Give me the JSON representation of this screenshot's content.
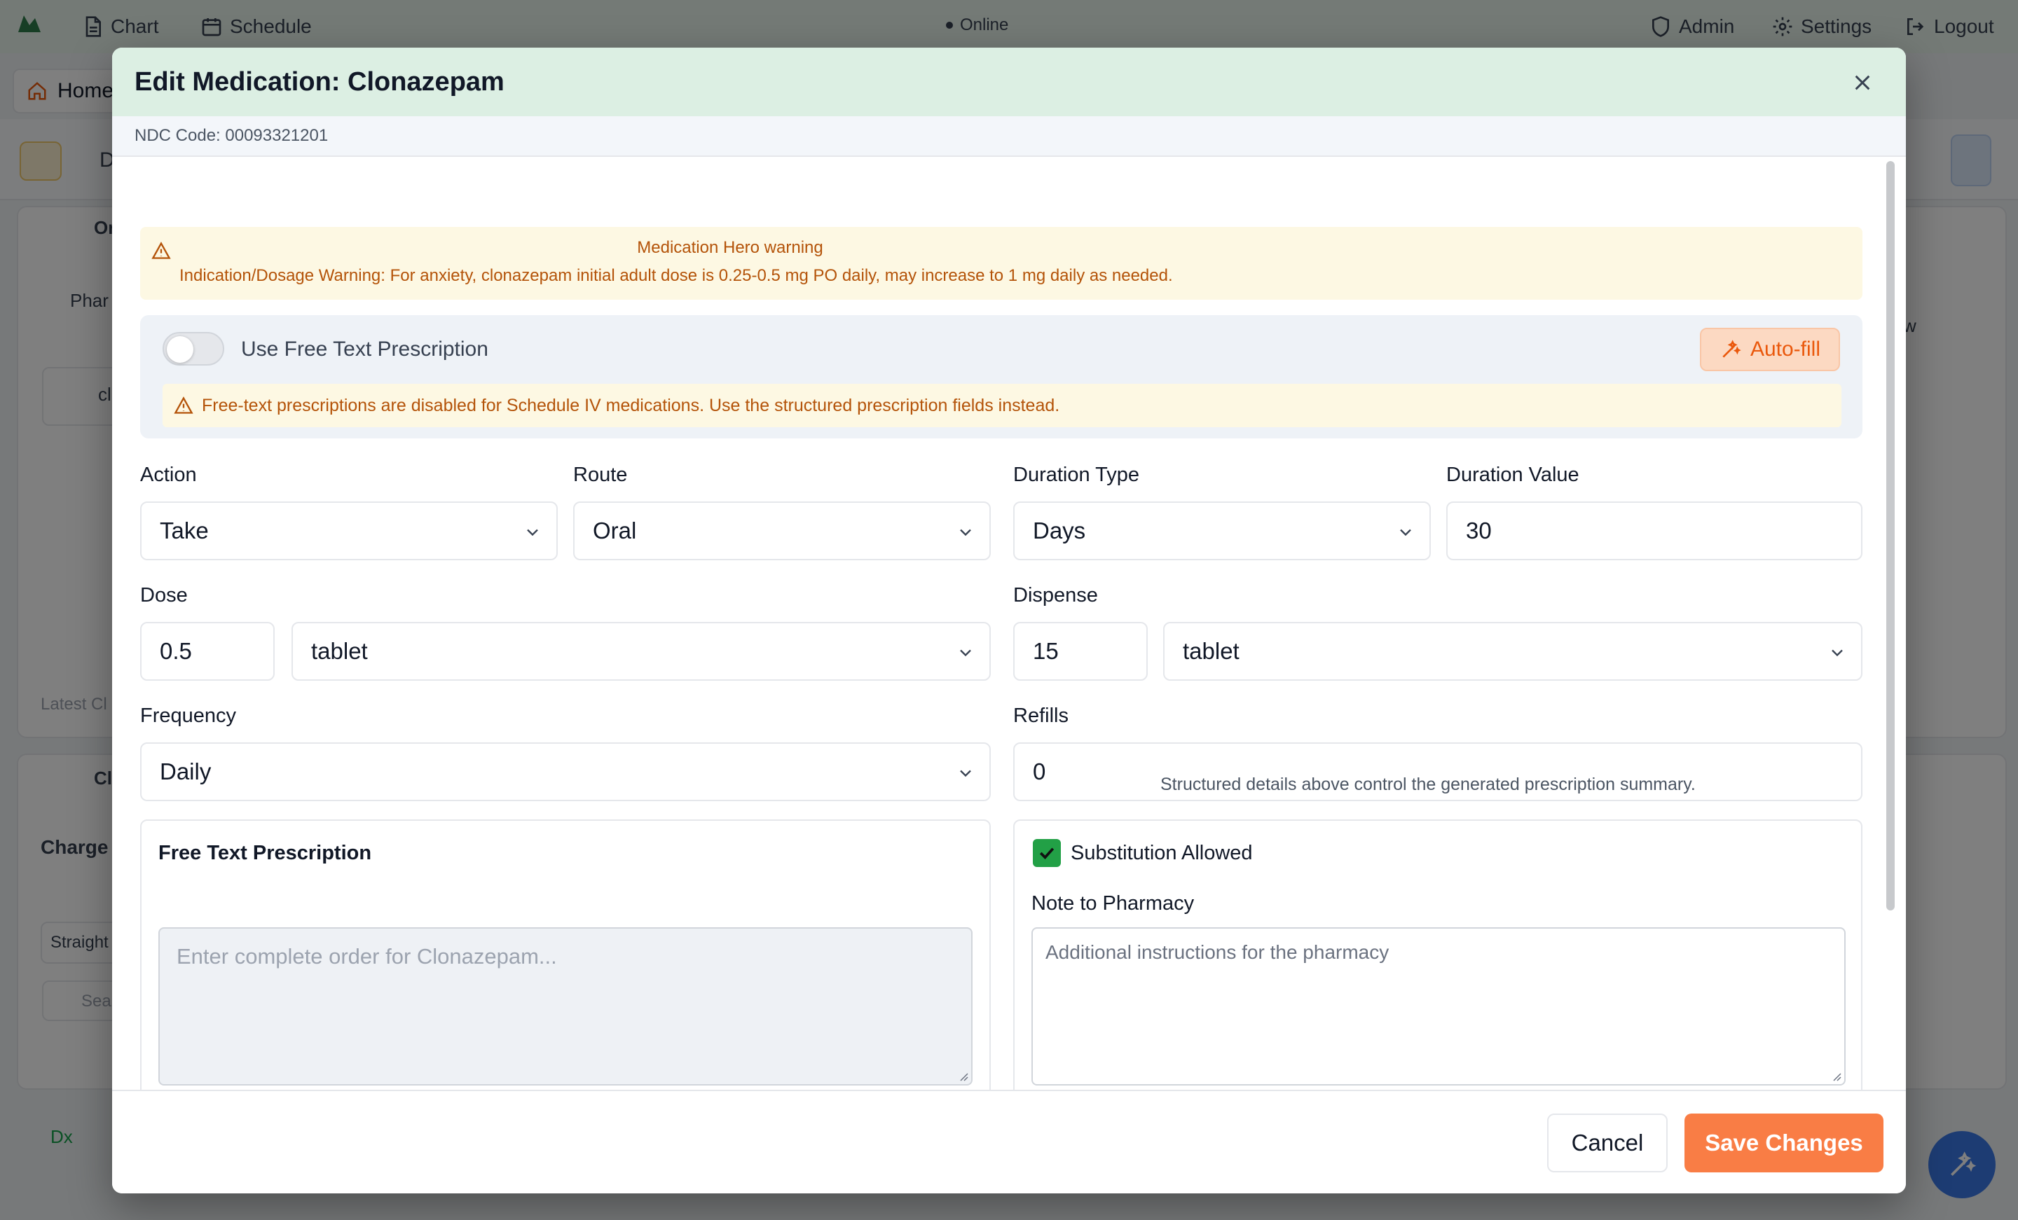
{
  "app": {
    "nav": {
      "chart_label": "Chart",
      "schedule_label": "Schedule",
      "status": "Online",
      "admin_label": "Admin",
      "settings_label": "Settings",
      "logout_label": "Logout"
    },
    "home_tab": "Home",
    "partial_texts": {
      "d": "D",
      "or": "Or",
      "phar": "Phar",
      "cl": "cl",
      "latest": "Latest Cl",
      "ch": "Cl",
      "charge": "Charge",
      "straight": "Straight",
      "sea": "Sea",
      "dx": "Dx",
      "w": "w"
    }
  },
  "modal": {
    "title": "Edit Medication: Clonazepam",
    "ndc_code": "NDC Code: 00093321201",
    "warning": {
      "title": "Medication Hero warning",
      "text": "Indication/Dosage Warning: For anxiety, clonazepam initial adult dose is 0.25-0.5 mg PO daily, may increase to 1 mg daily as needed."
    },
    "free_text_toggle": {
      "label": "Use Free Text Prescription",
      "enabled": false
    },
    "autofill_label": "Auto-fill",
    "schedule_warning": "Free-text prescriptions are disabled for Schedule IV medications. Use the structured prescription fields instead.",
    "fields": {
      "action": {
        "label": "Action",
        "value": "Take"
      },
      "route": {
        "label": "Route",
        "value": "Oral"
      },
      "duration_type": {
        "label": "Duration Type",
        "value": "Days"
      },
      "duration_value": {
        "label": "Duration Value",
        "value": "30"
      },
      "dose": {
        "label": "Dose",
        "value": "0.5",
        "unit": "tablet"
      },
      "dispense": {
        "label": "Dispense",
        "value": "15",
        "unit": "tablet"
      },
      "frequency": {
        "label": "Frequency",
        "value": "Daily"
      },
      "refills": {
        "label": "Refills",
        "value": "0"
      }
    },
    "hint": "Structured details above control the generated prescription summary.",
    "free_text_section": {
      "title": "Free Text Prescription",
      "placeholder": "Enter complete order for Clonazepam..."
    },
    "substitution": {
      "label": "Substitution Allowed",
      "checked": true
    },
    "pharmacy_note": {
      "label": "Note to Pharmacy",
      "placeholder": "Additional instructions for the pharmacy"
    },
    "buttons": {
      "cancel": "Cancel",
      "save": "Save Changes"
    }
  },
  "colors": {
    "header_bg": "#dcefe3",
    "warning_text": "#b45309",
    "primary": "#f97d45",
    "checkbox": "#22a046"
  }
}
